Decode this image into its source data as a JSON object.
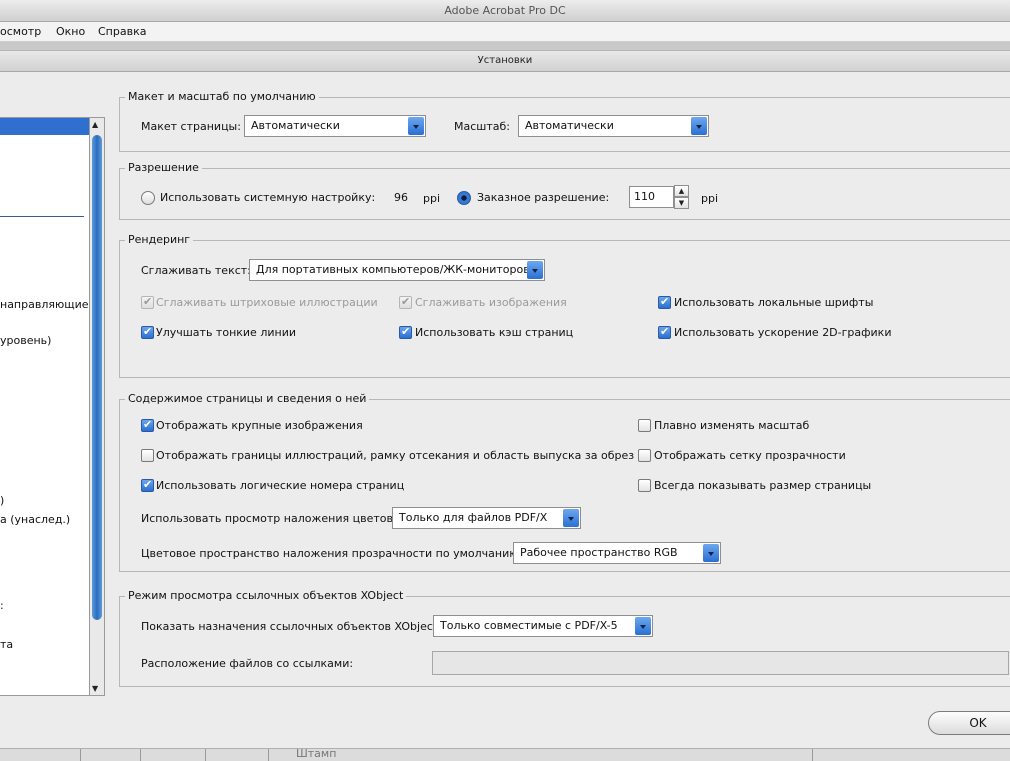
{
  "window": {
    "title": "Adobe Acrobat Pro DC"
  },
  "menubar": {
    "items": [
      "осмотр",
      "Окно",
      "Справка"
    ]
  },
  "dialog": {
    "title": "Установки"
  },
  "categories": {
    "items": [
      "направляющие",
      "уровень)",
      ")",
      "а (унаслед.)",
      ":",
      "та"
    ]
  },
  "layout_group": {
    "title": "Макет и масштаб по умолчанию",
    "page_layout_label": "Макет страницы:",
    "page_layout_value": "Автоматически",
    "zoom_label": "Масштаб:",
    "zoom_value": "Автоматически"
  },
  "resolution_group": {
    "title": "Разрешение",
    "system_label": "Использовать системную настройку:",
    "system_value": "96",
    "system_unit": "ppi",
    "system_selected": false,
    "custom_label": "Заказное разрешение:",
    "custom_value": "110",
    "custom_unit": "ppi",
    "custom_selected": true
  },
  "rendering_group": {
    "title": "Рендеринг",
    "smooth_text_label": "Сглаживать текст:",
    "smooth_text_value": "Для портативных компьютеров/ЖК-мониторов",
    "checkboxes": [
      {
        "label": "Сглаживать штриховые иллюстрации",
        "checked": true,
        "enabled": false
      },
      {
        "label": "Сглаживать изображения",
        "checked": true,
        "enabled": false
      },
      {
        "label": "Использовать локальные шрифты",
        "checked": true,
        "enabled": true
      },
      {
        "label": "Улучшать тонкие линии",
        "checked": true,
        "enabled": true
      },
      {
        "label": "Использовать кэш страниц",
        "checked": true,
        "enabled": true
      },
      {
        "label": "Использовать ускорение 2D-графики",
        "checked": true,
        "enabled": true
      }
    ]
  },
  "content_group": {
    "title": "Содержимое страницы и сведения о ней",
    "checkboxes": [
      {
        "label": "Отображать крупные изображения",
        "checked": true
      },
      {
        "label": "Плавно изменять масштаб",
        "checked": false
      },
      {
        "label": "Отображать границы иллюстраций, рамку отсекания и область выпуска за обрез",
        "checked": false
      },
      {
        "label": "Отображать сетку прозрачности",
        "checked": false
      },
      {
        "label": "Использовать логические номера страниц",
        "checked": true
      },
      {
        "label": "Всегда показывать размер страницы",
        "checked": false
      }
    ],
    "overprint_label": "Использовать просмотр наложения цветов:",
    "overprint_value": "Только для файлов PDF/X",
    "blend_space_label": "Цветовое пространство наложения прозрачности по умолчанию:",
    "blend_space_value": "Рабочее пространство RGB"
  },
  "xobject_group": {
    "title": "Режим просмотра ссылочных объектов XObject",
    "show_targets_label": "Показать назначения ссылочных объектов XObject:",
    "show_targets_value": "Только совместимые с PDF/X-5",
    "files_location_label": "Расположение файлов со ссылками:",
    "files_location_value": ""
  },
  "buttons": {
    "ok": "OK"
  },
  "background": {
    "stamp_text": "Штамп"
  }
}
